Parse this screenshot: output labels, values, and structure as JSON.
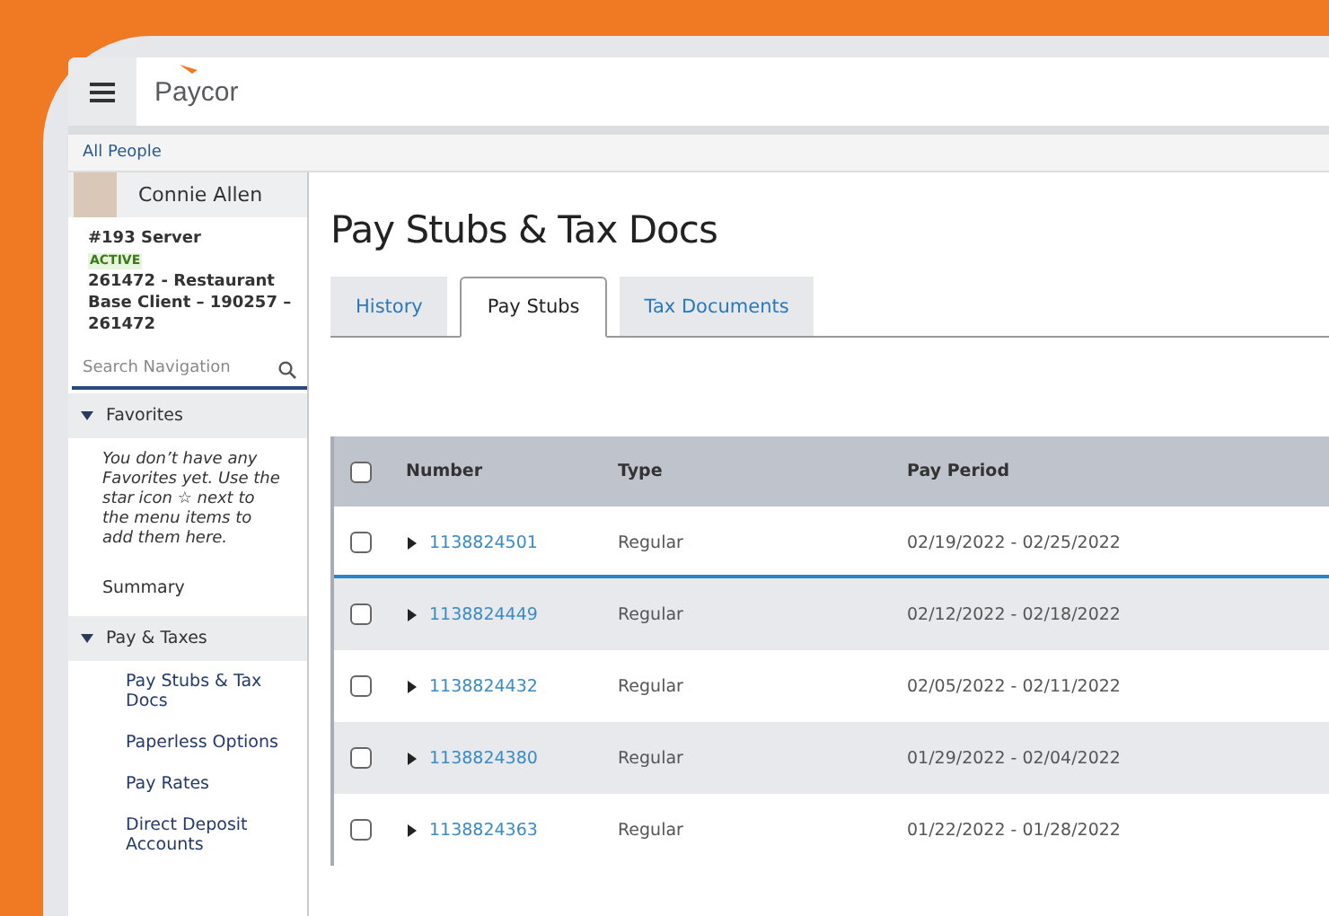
{
  "header": {
    "logo": "Paycor"
  },
  "breadcrumb": "All People",
  "profile": {
    "name": "Connie Allen",
    "position": "#193 Server",
    "status": "ACTIVE",
    "client": "261472 - Restaurant Base Client – 190257 – 261472"
  },
  "search": {
    "placeholder": "Search Navigation"
  },
  "sidebar": {
    "sections": [
      {
        "kind": "group",
        "label": "Favorites",
        "expanded": true,
        "note": "You don’t have any Favorites yet. Use the star icon ☆ next to the menu items to add them here."
      },
      {
        "kind": "link",
        "label": "Summary"
      },
      {
        "kind": "group",
        "label": "Pay & Taxes",
        "expanded": true,
        "children": [
          {
            "label": "Pay Stubs & Tax Docs"
          },
          {
            "label": "Paperless Options"
          },
          {
            "label": "Pay Rates"
          },
          {
            "label": "Direct Deposit Accounts"
          }
        ]
      }
    ]
  },
  "page_title": "Pay Stubs & Tax Docs",
  "tabs": [
    {
      "label": "History",
      "selected": false
    },
    {
      "label": "Pay Stubs",
      "selected": true
    },
    {
      "label": "Tax Documents",
      "selected": false
    }
  ],
  "table": {
    "columns": [
      "Number",
      "Type",
      "Pay Period"
    ],
    "header_checked": false,
    "rows": [
      {
        "number": "1138824501",
        "type": "Regular",
        "period": "02/19/2022 - 02/25/2022",
        "checked": false,
        "selected": true
      },
      {
        "number": "1138824449",
        "type": "Regular",
        "period": "02/12/2022 - 02/18/2022",
        "checked": false,
        "selected": false
      },
      {
        "number": "1138824432",
        "type": "Regular",
        "period": "02/05/2022 - 02/11/2022",
        "checked": false,
        "selected": false
      },
      {
        "number": "1138824380",
        "type": "Regular",
        "period": "01/29/2022 - 02/04/2022",
        "checked": false,
        "selected": false
      },
      {
        "number": "1138824363",
        "type": "Regular",
        "period": "01/22/2022 - 01/28/2022",
        "checked": false,
        "selected": false
      }
    ]
  }
}
